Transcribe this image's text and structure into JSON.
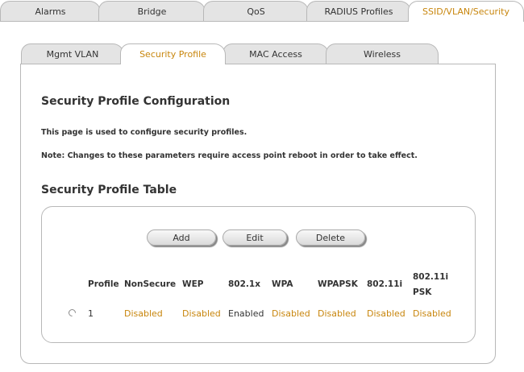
{
  "top_tabs": [
    "Alarms",
    "Bridge",
    "QoS",
    "RADIUS Profiles",
    "SSID/VLAN/Security"
  ],
  "sub_tabs": [
    "Mgmt VLAN",
    "Security Profile",
    "MAC Access",
    "Wireless"
  ],
  "page": {
    "title": "Security Profile Configuration",
    "description": "This page is used to configure security profiles.",
    "note": "Note: Changes to these parameters require access point reboot in order to take effect.",
    "table_title": "Security Profile Table"
  },
  "buttons": {
    "add": "Add",
    "edit": "Edit",
    "delete": "Delete"
  },
  "table": {
    "headers": [
      "Profile",
      "NonSecure",
      "WEP",
      "802.1x",
      "WPA",
      "WPAPSK",
      "802.11i",
      "802.11i",
      "PSK"
    ],
    "row": [
      "1",
      "Disabled",
      "Disabled",
      "Enabled",
      "Disabled",
      "Disabled",
      "Disabled",
      "Disabled"
    ]
  },
  "colors": {
    "accent": "#c8860d",
    "border": "#b8b8b8"
  }
}
